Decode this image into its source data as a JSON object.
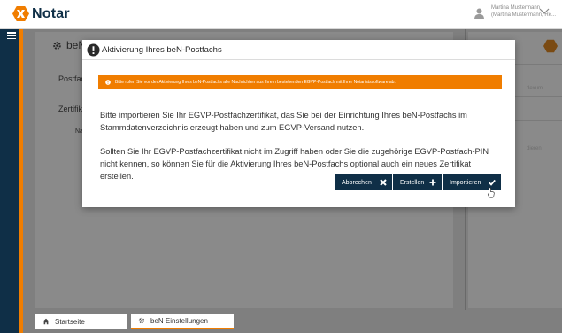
{
  "header": {
    "app_name": "Notar",
    "user_line1": "Martina Mustermann",
    "user_line2": "(Martina Mustermann, Re...",
    "user_icon": "user-icon",
    "chevron_icon": "chevron-down-icon"
  },
  "colors": {
    "brand_orange": "#f07d00",
    "navy": "#0f2f47"
  },
  "background": {
    "panel_title": "beN Ei",
    "postfach_label": "Postfach",
    "zertifikate_label": "Zertifikate",
    "name_label": "Name",
    "right_items": [
      "dexum",
      "",
      "dieren"
    ]
  },
  "modal": {
    "title": "Aktivierung Ihres beN-Postfachs",
    "warning": "Bitte rufen Sie vor der Aktivierung Ihres beN-Postfachs alle Nachrichten aus Ihrem bestehenden EGVP-Postfach mit Ihrer Notariatssoftware ab.",
    "paragraph1": "Bitte importieren Sie Ihr EGVP-Postfachzertifikat, das Sie bei der Einrichtung Ihres beN-Postfachs im Stammdatenverzeichnis erzeugt haben und zum EGVP-Versand nutzen.",
    "paragraph2": "Sollten Sie Ihr EGVP-Postfachzertifikat nicht im Zugriff haben oder Sie die zugehörige EGVP-Postfach-PIN nicht kennen, so können Sie für die Aktivierung Ihres beN-Postfachs optional auch ein neues Zertifikat erstellen.",
    "buttons": {
      "cancel": "Abbrechen",
      "create": "Erstellen",
      "import": "Importieren"
    }
  },
  "tabs": [
    {
      "label": "Startseite",
      "icon": "home-icon"
    },
    {
      "label": "beN Einstellungen",
      "icon": "gear-icon"
    }
  ]
}
